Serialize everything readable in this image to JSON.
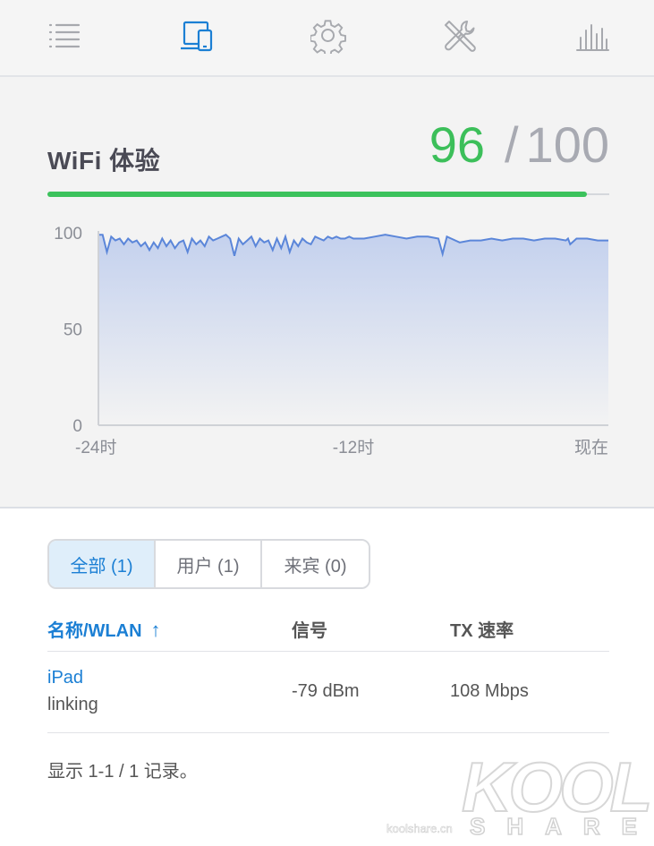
{
  "wifi": {
    "title": "WiFi 体验",
    "score": "96",
    "separator": "/",
    "max": "100",
    "progress_fraction": 0.96
  },
  "chart_data": {
    "type": "area",
    "y_ticks": [
      "100",
      "50",
      "0"
    ],
    "x_ticks": [
      "-24时",
      "-12时",
      "现在"
    ],
    "ylim": [
      0,
      100
    ],
    "xlim": [
      -24,
      0
    ],
    "x": [
      -24,
      -23.8,
      -23.6,
      -23.4,
      -23.2,
      -23,
      -22.8,
      -22.6,
      -22.4,
      -22.2,
      -22,
      -21.8,
      -21.6,
      -21.4,
      -21.2,
      -21,
      -20.8,
      -20.6,
      -20.4,
      -20.2,
      -20,
      -19.8,
      -19.6,
      -19.4,
      -19.2,
      -19,
      -18.8,
      -18.6,
      -18.4,
      -18.2,
      -18,
      -17.8,
      -17.6,
      -17.4,
      -17.2,
      -17,
      -16.8,
      -16.6,
      -16.4,
      -16.2,
      -16,
      -15.8,
      -15.6,
      -15.4,
      -15.2,
      -15,
      -14.8,
      -14.6,
      -14.4,
      -14.2,
      -14,
      -13.8,
      -13.6,
      -13.4,
      -13.2,
      -13,
      -12.8,
      -12.6,
      -12.4,
      -12.2,
      -12,
      -11.5,
      -11,
      -10.5,
      -10,
      -9.5,
      -9,
      -8.5,
      -8,
      -7.8,
      -7.6,
      -7.4,
      -7,
      -6.5,
      -6,
      -5.5,
      -5,
      -4.5,
      -4,
      -3.5,
      -3,
      -2.5,
      -2,
      -1.9,
      -1.8,
      -1.5,
      -1,
      -0.5,
      0
    ],
    "values": [
      99,
      99,
      90,
      98,
      96,
      97,
      94,
      97,
      95,
      96,
      93,
      95,
      91,
      95,
      92,
      97,
      93,
      96,
      92,
      95,
      96,
      90,
      97,
      94,
      96,
      93,
      98,
      96,
      97,
      98,
      99,
      97,
      88,
      97,
      94,
      96,
      98,
      93,
      97,
      95,
      96,
      91,
      97,
      92,
      98,
      90,
      96,
      93,
      97,
      95,
      94,
      98,
      97,
      96,
      98,
      97,
      98,
      97,
      97,
      98,
      97,
      97,
      98,
      99,
      98,
      97,
      98,
      98,
      97,
      89,
      98,
      97,
      95,
      96,
      96,
      97,
      96,
      97,
      97,
      96,
      97,
      97,
      96,
      97,
      94,
      97,
      97,
      96,
      96
    ],
    "colors": {
      "line": "#5b86d9",
      "fill_top": "#c4d1ee",
      "fill_bottom": "#f3f3f3",
      "axis": "#cfd1d6"
    }
  },
  "tabs": [
    {
      "label": "全部 (1)",
      "active": true
    },
    {
      "label": "用户 (1)",
      "active": false
    },
    {
      "label": "来宾 (0)",
      "active": false
    }
  ],
  "table": {
    "columns": {
      "name": "名称/WLAN",
      "sort_indicator": "↑",
      "signal": "信号",
      "tx": "TX 速率"
    },
    "rows": [
      {
        "name": "iPad",
        "wlan": "linking",
        "signal": "-79 dBm",
        "tx": "108 Mbps"
      }
    ]
  },
  "footer": {
    "records": "显示 1-1 / 1 记录。"
  },
  "watermark": {
    "brand": "KOOL",
    "sub": "SHARE",
    "site": "koolshare.cn"
  },
  "colors": {
    "accent": "#1b7fd4",
    "score_green": "#3cbf5a",
    "icon_gray": "#a7a9ae"
  }
}
